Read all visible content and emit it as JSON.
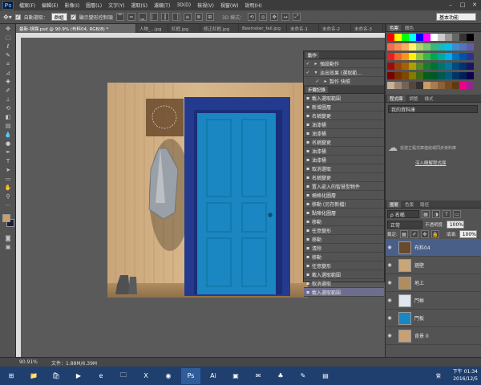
{
  "menubar": {
    "logo": "Ps",
    "items": [
      "檔案(F)",
      "編輯(E)",
      "影像(I)",
      "圖層(L)",
      "文字(Y)",
      "選取(S)",
      "濾鏡(T)",
      "3D(D)",
      "檢視(V)",
      "視窗(W)",
      "說明(H)"
    ],
    "controls": [
      "–",
      "□",
      "✕"
    ]
  },
  "options": {
    "auto_select_label": "自動選取：",
    "auto_select_value": "群組",
    "transform_label": "顯示變形控制項",
    "mode_label": "3D 模式："
  },
  "workspace": {
    "label": "基本功能"
  },
  "tabs": [
    {
      "label": "最新-胡爛.psd @ 90.9% (布料04, RGB/8) *",
      "active": true
    },
    {
      "label": "人物_...jpg"
    },
    {
      "label": "紅框.jpg"
    },
    {
      "label": "修正紅框.jpg"
    },
    {
      "label": "Beemster_fall.jpg"
    },
    {
      "label": "未命名-1"
    },
    {
      "label": "未命名-2"
    },
    {
      "label": "未命名-3"
    }
  ],
  "tools": [
    "move-icon",
    "marquee-icon",
    "lasso-icon",
    "quick-select-icon",
    "crop-icon",
    "eyedropper-icon",
    "healing-icon",
    "brush-icon",
    "stamp-icon",
    "history-brush-icon",
    "eraser-icon",
    "gradient-icon",
    "blur-icon",
    "dodge-icon",
    "pen-icon",
    "type-icon",
    "path-select-icon",
    "shape-icon",
    "hand-icon",
    "zoom-icon"
  ],
  "swatches_panel": {
    "tabs": [
      "色票",
      "顏色"
    ]
  },
  "libraries_panel": {
    "tabs": [
      "程式庫",
      "調整",
      "樣式"
    ],
    "select_value": "我的資料庫",
    "sync_text": "從建立程式庫連結或同步資料庫",
    "link_text": "深入瞭解程式庫"
  },
  "actions_panel": {
    "title": "動作",
    "rows": [
      "預設動作",
      "淡出效果 (選取範...",
      "製作 快照"
    ]
  },
  "history_panel": {
    "title": "步驟記錄",
    "rows": [
      "載入選取範圍",
      "新增圖層",
      "名稱變更",
      "油漆桶",
      "油漆桶",
      "名稱變更",
      "油漆桶",
      "油漆桶",
      "取消選取",
      "名稱變更",
      "置入嵌入的智慧型物件",
      "柵格化圖層",
      "移動 (另存新檔)",
      "點陣化圖層",
      "移動",
      "任意變形",
      "移動",
      "清除",
      "移動",
      "任意變形",
      "載入選取範圍",
      "取消選取",
      "載入選取範圍"
    ]
  },
  "layers_panel": {
    "tabs": [
      "圖層",
      "色版",
      "路徑"
    ],
    "filter_label": "ρ 名稱",
    "blend_mode": "正常",
    "opacity_label": "不透明度:",
    "opacity_value": "100%",
    "lock_label": "鎖定:",
    "fill_label": "填滿:",
    "fill_value": "100%",
    "layers": [
      {
        "name": "布料04",
        "selected": true
      },
      {
        "name": "牆壁"
      },
      {
        "name": "地上"
      },
      {
        "name": "門框"
      },
      {
        "name": "門板"
      },
      {
        "name": "背景 0"
      }
    ]
  },
  "status": {
    "zoom": "90.91%",
    "doc": "文件：1.88M/6.39M"
  },
  "taskbar": {
    "time": "下午 01:34",
    "date": "2016/12/5",
    "lang": "繁",
    "apps": [
      "windows-logo-icon",
      "file-explorer-icon",
      "store-icon",
      "media-icon",
      "ie-icon",
      "folder-icon",
      "excel-icon",
      "chrome-icon",
      "photoshop-icon",
      "illustrator-icon",
      "video-icon",
      "chat-icon",
      "game-icon",
      "paint-icon",
      "notepad-icon"
    ]
  },
  "colors": {
    "accent": "#3a7bd5",
    "door": "#1a86c2",
    "frame": "#243a8e",
    "foreground": "#c9a06a",
    "background": "#1a1f3a"
  }
}
